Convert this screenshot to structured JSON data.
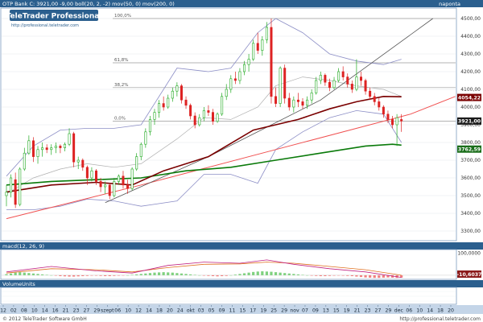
{
  "window": {
    "bg": "#ffffff",
    "frame_color": "#2b5f8e"
  },
  "header": {
    "title": "OTP Bank C: 3921,00  -9,00  boll(20, 2, -2)  mov(50, 0)  mov(200, 0)",
    "period": "naponta",
    "logo_title": "TeleTrader Professional",
    "logo_url": "http://professional.teletrader.com"
  },
  "panels": {
    "macd_title": "macd(12, 26, 9)",
    "volume_title": "VolumeUnits"
  },
  "footer": {
    "copyright": "© 2012 TeleTrader Software GmbH",
    "url": "http://professional.teletrader.com"
  },
  "chart_data": {
    "type": "candlestick",
    "title": "OTP Bank",
    "last_close": 3921.0,
    "change": -9.0,
    "ylim": [
      3250,
      4550
    ],
    "y_ticks": [
      3300,
      3400,
      3500,
      3600,
      3700,
      3800,
      3900,
      4000,
      4100,
      4200,
      4300,
      4400,
      4500
    ],
    "y_tick_labels": [
      "3300,00",
      "3400,00",
      "3500,00",
      "3600,00",
      "3700,00",
      "3800,00",
      "3900,00",
      "4000,00",
      "4100,00",
      "4200,00",
      "4300,00",
      "4400,00",
      "4500,00"
    ],
    "x_tick_labels": [
      "12",
      "02",
      "08",
      "10",
      "14",
      "16",
      "21",
      "23",
      "27",
      "29",
      "szept",
      "06",
      "10",
      "12",
      "14",
      "18",
      "20",
      "24",
      "okt",
      "03",
      "05",
      "09",
      "11",
      "15",
      "17",
      "19",
      "25",
      "29",
      "nov",
      "07",
      "09",
      "13",
      "15",
      "19",
      "21",
      "23",
      "27",
      "29",
      "dec",
      "06",
      "10",
      "14",
      "18",
      "20"
    ],
    "n_days": 100,
    "ohlc": [
      [
        3500,
        3560,
        3440,
        3520
      ],
      [
        3520,
        3620,
        3490,
        3600
      ],
      [
        3590,
        3630,
        3430,
        3450
      ],
      [
        3450,
        3660,
        3440,
        3650
      ],
      [
        3650,
        3770,
        3640,
        3740
      ],
      [
        3740,
        3840,
        3730,
        3810
      ],
      [
        3810,
        3830,
        3690,
        3720
      ],
      [
        3720,
        3780,
        3680,
        3760
      ],
      [
        3760,
        3800,
        3720,
        3770
      ],
      [
        3770,
        3790,
        3740,
        3760
      ],
      [
        3760,
        3790,
        3730,
        3770
      ],
      [
        3770,
        3800,
        3740,
        3780
      ],
      [
        3780,
        3790,
        3740,
        3770
      ],
      [
        3770,
        3800,
        3750,
        3790
      ],
      [
        3790,
        3880,
        3780,
        3850
      ],
      [
        3850,
        3860,
        3660,
        3690
      ],
      [
        3690,
        3720,
        3650,
        3700
      ],
      [
        3700,
        3710,
        3640,
        3660
      ],
      [
        3660,
        3670,
        3560,
        3600
      ],
      [
        3600,
        3660,
        3580,
        3640
      ],
      [
        3640,
        3650,
        3560,
        3580
      ],
      [
        3580,
        3600,
        3520,
        3550
      ],
      [
        3550,
        3580,
        3510,
        3560
      ],
      [
        3560,
        3570,
        3480,
        3500
      ],
      [
        3500,
        3600,
        3490,
        3580
      ],
      [
        3580,
        3620,
        3560,
        3610
      ],
      [
        3610,
        3640,
        3540,
        3560
      ],
      [
        3560,
        3590,
        3510,
        3540
      ],
      [
        3540,
        3660,
        3530,
        3650
      ],
      [
        3650,
        3740,
        3640,
        3720
      ],
      [
        3720,
        3800,
        3700,
        3790
      ],
      [
        3790,
        3880,
        3770,
        3860
      ],
      [
        3860,
        3950,
        3840,
        3930
      ],
      [
        3930,
        3990,
        3900,
        3970
      ],
      [
        3970,
        4040,
        3940,
        4020
      ],
      [
        4020,
        4060,
        3980,
        4000
      ],
      [
        4000,
        4070,
        3990,
        4050
      ],
      [
        4050,
        4110,
        4030,
        4090
      ],
      [
        4090,
        4140,
        4060,
        4120
      ],
      [
        4120,
        4130,
        4020,
        4040
      ],
      [
        4040,
        4060,
        3990,
        4010
      ],
      [
        4010,
        4020,
        3930,
        3950
      ],
      [
        3950,
        3970,
        3880,
        3900
      ],
      [
        3900,
        3960,
        3890,
        3940
      ],
      [
        3940,
        4000,
        3920,
        3980
      ],
      [
        3980,
        4010,
        3950,
        3970
      ],
      [
        3970,
        3990,
        3900,
        3920
      ],
      [
        3920,
        3970,
        3910,
        3960
      ],
      [
        3960,
        4080,
        3950,
        4060
      ],
      [
        4060,
        4130,
        4040,
        4100
      ],
      [
        4100,
        4180,
        4080,
        4160
      ],
      [
        4160,
        4200,
        4130,
        4150
      ],
      [
        4150,
        4220,
        4130,
        4200
      ],
      [
        4200,
        4260,
        4180,
        4240
      ],
      [
        4240,
        4300,
        4200,
        4270
      ],
      [
        4270,
        4380,
        4260,
        4360
      ],
      [
        4360,
        4420,
        4300,
        4320
      ],
      [
        4320,
        4400,
        4290,
        4380
      ],
      [
        4380,
        4480,
        4360,
        4450
      ],
      [
        4450,
        4500,
        4020,
        4060
      ],
      [
        4060,
        4110,
        4000,
        4020
      ],
      [
        4020,
        4230,
        4000,
        4220
      ],
      [
        4220,
        4240,
        4020,
        4050
      ],
      [
        4050,
        4080,
        3980,
        4000
      ],
      [
        4000,
        4060,
        3970,
        4040
      ],
      [
        4040,
        4080,
        4000,
        4030
      ],
      [
        4030,
        4050,
        3990,
        4010
      ],
      [
        4010,
        4060,
        3990,
        4040
      ],
      [
        4040,
        4100,
        4020,
        4080
      ],
      [
        4080,
        4170,
        4070,
        4150
      ],
      [
        4150,
        4200,
        4130,
        4180
      ],
      [
        4180,
        4190,
        4120,
        4140
      ],
      [
        4140,
        4160,
        4090,
        4110
      ],
      [
        4110,
        4170,
        4100,
        4150
      ],
      [
        4150,
        4220,
        4140,
        4200
      ],
      [
        4200,
        4230,
        4150,
        4170
      ],
      [
        4170,
        4190,
        4110,
        4130
      ],
      [
        4130,
        4150,
        4080,
        4100
      ],
      [
        4100,
        4270,
        4090,
        4170
      ],
      [
        4170,
        4200,
        4120,
        4150
      ],
      [
        4150,
        4160,
        4070,
        4090
      ],
      [
        4090,
        4110,
        4040,
        4060
      ],
      [
        4060,
        4080,
        4010,
        4030
      ],
      [
        4030,
        4050,
        3980,
        4000
      ],
      [
        4000,
        4010,
        3940,
        3960
      ],
      [
        3960,
        3980,
        3910,
        3930
      ],
      [
        3930,
        3950,
        3880,
        3900
      ],
      [
        3900,
        3960,
        3780,
        3940
      ],
      [
        3930,
        3960,
        3860,
        3921
      ]
    ],
    "lines": {
      "sma200": [
        [
          0,
          3560
        ],
        [
          10,
          3580
        ],
        [
          20,
          3590
        ],
        [
          30,
          3600
        ],
        [
          40,
          3640
        ],
        [
          50,
          3660
        ],
        [
          60,
          3700
        ],
        [
          70,
          3740
        ],
        [
          80,
          3780
        ],
        [
          86,
          3790
        ],
        [
          88,
          3785
        ]
      ],
      "sma50": [
        [
          0,
          3520
        ],
        [
          10,
          3560
        ],
        [
          20,
          3575
        ],
        [
          28,
          3560
        ],
        [
          35,
          3640
        ],
        [
          45,
          3720
        ],
        [
          55,
          3870
        ],
        [
          65,
          3930
        ],
        [
          72,
          3990
        ],
        [
          78,
          4030
        ],
        [
          84,
          4060
        ],
        [
          88,
          4058
        ]
      ],
      "trend_red": [
        [
          0,
          3370
        ],
        [
          30,
          3560
        ],
        [
          60,
          3760
        ],
        [
          90,
          3960
        ],
        [
          100,
          4060
        ]
      ],
      "trend_black": [
        [
          22,
          3460
        ],
        [
          45,
          3720
        ],
        [
          70,
          4040
        ],
        [
          95,
          4500
        ]
      ],
      "boll_upper": [
        [
          0,
          3610
        ],
        [
          6,
          3780
        ],
        [
          12,
          3870
        ],
        [
          18,
          3880
        ],
        [
          24,
          3880
        ],
        [
          30,
          3900
        ],
        [
          38,
          4220
        ],
        [
          45,
          4200
        ],
        [
          50,
          4220
        ],
        [
          56,
          4420
        ],
        [
          60,
          4500
        ],
        [
          66,
          4420
        ],
        [
          72,
          4300
        ],
        [
          78,
          4260
        ],
        [
          84,
          4240
        ],
        [
          88,
          4270
        ]
      ],
      "boll_lower": [
        [
          0,
          3420
        ],
        [
          6,
          3420
        ],
        [
          12,
          3440
        ],
        [
          18,
          3480
        ],
        [
          24,
          3470
        ],
        [
          30,
          3440
        ],
        [
          38,
          3470
        ],
        [
          44,
          3620
        ],
        [
          50,
          3620
        ],
        [
          56,
          3570
        ],
        [
          60,
          3760
        ],
        [
          66,
          3860
        ],
        [
          72,
          3940
        ],
        [
          78,
          3980
        ],
        [
          84,
          3960
        ],
        [
          88,
          3800
        ]
      ],
      "boll_mid": [
        [
          0,
          3510
        ],
        [
          6,
          3600
        ],
        [
          12,
          3650
        ],
        [
          18,
          3680
        ],
        [
          24,
          3660
        ],
        [
          30,
          3680
        ],
        [
          38,
          3820
        ],
        [
          44,
          3940
        ],
        [
          50,
          3930
        ],
        [
          56,
          4000
        ],
        [
          60,
          4120
        ],
        [
          66,
          4170
        ],
        [
          72,
          4150
        ],
        [
          78,
          4120
        ],
        [
          84,
          4100
        ],
        [
          88,
          4060
        ]
      ]
    },
    "fib_levels": [
      {
        "label": "100,0%",
        "value": 4500
      },
      {
        "label": "61,8%",
        "value": 4250
      },
      {
        "label": "38,2%",
        "value": 4110
      },
      {
        "label": "0,0%",
        "value": 3921
      }
    ],
    "price_labels": [
      {
        "text": "4054,22",
        "value": 4054.22,
        "color": "#7a0000"
      },
      {
        "text": "3921,00",
        "value": 3921.0,
        "color": "#1a1a1a"
      },
      {
        "text": "3762,59",
        "value": 3762.59,
        "color": "#1a6e1a"
      }
    ],
    "macd": {
      "ylim": [
        -15,
        110
      ],
      "y_labels": [
        {
          "text": "100,0000",
          "value": 100
        }
      ],
      "last_label": "-10,6037",
      "histogram": [
        5,
        8,
        12,
        14,
        12,
        10,
        8,
        6,
        4,
        2,
        0,
        -2,
        -4,
        -5,
        -6,
        -6,
        -5,
        -4,
        -3,
        -2,
        -2,
        -3,
        -4,
        -4,
        -3,
        -2,
        -1,
        0,
        2,
        4,
        6,
        8,
        10,
        12,
        13,
        14,
        13,
        12,
        10,
        8,
        6,
        4,
        2,
        0,
        -2,
        -3,
        -4,
        -5,
        -4,
        -3,
        0,
        3,
        6,
        9,
        12,
        15,
        17,
        18,
        17,
        16,
        14,
        12,
        10,
        8,
        6,
        4,
        2,
        0,
        -2,
        -3,
        -4,
        -4,
        -3,
        -2,
        -1,
        -2,
        -3,
        -4,
        -6,
        -8,
        -10,
        -11,
        -12,
        -12,
        -11,
        -10,
        -11,
        -12,
        -11
      ],
      "macd_line": [
        [
          0,
          15
        ],
        [
          10,
          40
        ],
        [
          20,
          20
        ],
        [
          28,
          10
        ],
        [
          36,
          45
        ],
        [
          44,
          60
        ],
        [
          52,
          55
        ],
        [
          58,
          70
        ],
        [
          64,
          50
        ],
        [
          72,
          30
        ],
        [
          80,
          15
        ],
        [
          88,
          -10
        ]
      ],
      "signal_line": [
        [
          0,
          10
        ],
        [
          10,
          30
        ],
        [
          20,
          25
        ],
        [
          28,
          15
        ],
        [
          36,
          35
        ],
        [
          44,
          50
        ],
        [
          52,
          52
        ],
        [
          58,
          60
        ],
        [
          64,
          55
        ],
        [
          72,
          40
        ],
        [
          80,
          25
        ],
        [
          88,
          0
        ]
      ]
    }
  }
}
